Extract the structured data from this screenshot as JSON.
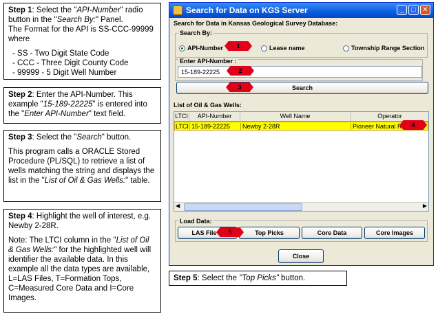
{
  "steps": {
    "step1": {
      "title": "Step 1",
      "text_a": ": Select the \"",
      "italic_a": "API-Number",
      "text_b": "\" radio button in the \"",
      "italic_b": "Search By:",
      "text_c": "\" Panel.",
      "format_line": "The Format for the API is SS-CCC-99999 where",
      "items": [
        "SS -  Two Digit State Code",
        "CCC - Three Digit County Code",
        "99999 - 5 Digit Well Number"
      ]
    },
    "step2": {
      "title": "Step 2",
      "text_a": ": Enter the API-Number. This example \"",
      "italic_a": "15-189-22225",
      "text_b": "\" is entered into the \"",
      "italic_b": "Enter API-Number",
      "text_c": "\" text field."
    },
    "step3": {
      "title": "Step 3",
      "text_a": ": Select the \"",
      "italic_a": "Search",
      "text_b": "\" button.",
      "para2_a": "This program calls a ORACLE Stored Procedure (PL/SQL) to retrieve a list of wells matching the string and displays the list in the \"",
      "para2_italic": "List of Oil & Gas Wells:",
      "para2_b": "\" table."
    },
    "step4": {
      "title": "Step 4",
      "text_a": ": Highlight the well of interest, e.g. Newby 2-28R.",
      "note_a": "Note: The LTCI column in the \"",
      "note_italic": "List of Oil & Gas Wells:",
      "note_b": "\" for the highlighted well will identifier the available data. In this example all the data types are available, L=LAS Files, T=Formation Tops, C=Measured Core Data and I=Core Images."
    },
    "step5": {
      "title": "Step 5",
      "text_a": ": Select the ",
      "italic_a": "\"Top Picks\"",
      "text_b": " button."
    }
  },
  "window": {
    "title": "Search for Data on KGS Server",
    "group_title": "Search for Data in Kansas Geological Survey Database:",
    "search_by": {
      "legend": "Search By:",
      "options": [
        "API-Number",
        "Lease name",
        "Township Range Section"
      ],
      "selected": "API-Number"
    },
    "api": {
      "legend": "Enter API-Number :",
      "value": "15-189-22225"
    },
    "search_button": "Search",
    "wells": {
      "legend": "List of Oil & Gas Wells:",
      "columns": [
        "LTCI",
        "API-Number",
        "Well Name",
        "Operator"
      ],
      "rows": [
        [
          "LTCI",
          "15-189-22225",
          "Newby 2-28R",
          "Pioneer Natural R"
        ]
      ],
      "highlight_color": "#ffff00"
    },
    "load": {
      "legend": "Load Data:",
      "buttons": [
        "LAS File D",
        "Top Picks",
        "Core Data",
        "Core Images"
      ]
    },
    "close_button": "Close",
    "markers": [
      "1",
      "2",
      "3",
      "4",
      "5"
    ],
    "marker_color": "#e0001a",
    "titlebar_color": "#0a5ee0"
  }
}
